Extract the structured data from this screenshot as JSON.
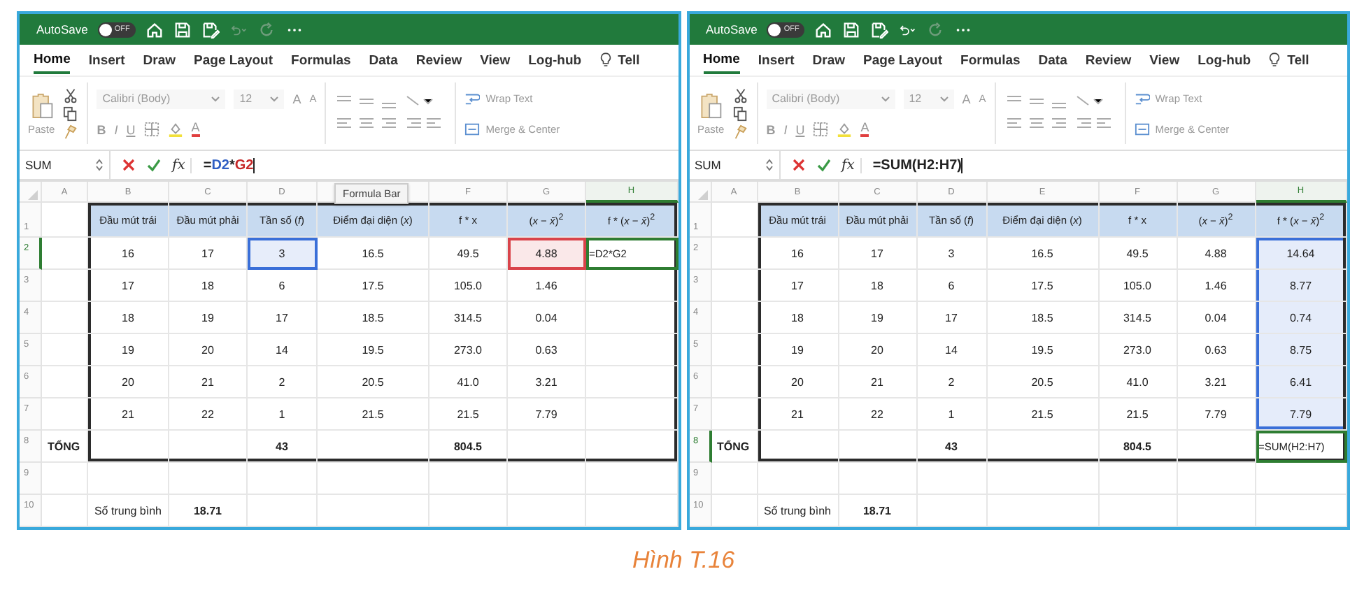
{
  "panels": [
    {
      "autosave": {
        "label": "AutoSave",
        "toggle": "OFF",
        "on": false
      },
      "undo_enabled": false,
      "tabs": [
        {
          "label": "Home",
          "selected": true
        },
        {
          "label": "Insert",
          "selected": false
        },
        {
          "label": "Draw",
          "selected": false
        },
        {
          "label": "Page Layout",
          "selected": false
        },
        {
          "label": "Formulas",
          "selected": false
        },
        {
          "label": "Data",
          "selected": false
        },
        {
          "label": "Review",
          "selected": false
        },
        {
          "label": "View",
          "selected": false
        },
        {
          "label": "Log-hub",
          "selected": false
        }
      ],
      "tell": "Tell",
      "ribbon": {
        "paste": "Paste",
        "font": "Calibri (Body)",
        "size": "12",
        "grow": "A",
        "shrink": "A",
        "styles": [
          "B",
          "I",
          "U"
        ],
        "font_color": "A",
        "wrap": "Wrap Text",
        "merge": "Merge & Center"
      },
      "name_box": "SUM",
      "fx": "fx",
      "formula_parts": [
        {
          "text": "=",
          "color": "#222222"
        },
        {
          "text": "D2",
          "color": "#2f5fc4"
        },
        {
          "text": "*",
          "color": "#222222"
        },
        {
          "text": "G2",
          "color": "#c62828"
        }
      ],
      "tooltip": "Formula Bar",
      "columns": [
        {
          "label": "A",
          "selected": false
        },
        {
          "label": "B",
          "selected": false
        },
        {
          "label": "C",
          "selected": false
        },
        {
          "label": "D",
          "selected": false
        },
        {
          "selected": false
        },
        {
          "label": "F",
          "selected": false
        },
        {
          "label": "G",
          "selected": false
        },
        {
          "label": "H",
          "selected": true
        }
      ],
      "rows": [
        {
          "n": "1",
          "selected": false,
          "cells": [
            {
              "kind": "plain"
            },
            {
              "text": "Đầu mút trái",
              "kind": "head"
            },
            {
              "text": "Đầu mút phải",
              "kind": "head"
            },
            {
              "text": "Tần số (*f*)",
              "kind": "head"
            },
            {
              "text": "Điểm đại diện (*x*)",
              "kind": "head"
            },
            {
              "text": "f * x",
              "kind": "head"
            },
            {
              "text": "(*x* − *x̄*)$^{2}$",
              "kind": "head"
            },
            {
              "text": "f * (*x* − *x̄*)$^{2}$",
              "kind": "head"
            }
          ]
        },
        {
          "n": "2",
          "selected": true,
          "cells": [
            {
              "kind": "plain"
            },
            {
              "text": "16",
              "kind": "plain"
            },
            {
              "text": "17",
              "kind": "plain"
            },
            {
              "text": "3",
              "kind": "ref",
              "color": "#3a6fd8"
            },
            {
              "text": "16.5",
              "kind": "plain"
            },
            {
              "text": "49.5",
              "kind": "plain"
            },
            {
              "text": "4.88",
              "kind": "ref",
              "color": "#d9434a"
            },
            {
              "text": "=D2*G2",
              "kind": "active",
              "color": "#2e7d32"
            }
          ]
        },
        {
          "n": "3",
          "selected": false,
          "cells": [
            {
              "kind": "plain"
            },
            {
              "text": "17",
              "kind": "plain"
            },
            {
              "text": "18",
              "kind": "plain"
            },
            {
              "text": "6",
              "kind": "plain"
            },
            {
              "text": "17.5",
              "kind": "plain"
            },
            {
              "text": "105.0",
              "kind": "plain"
            },
            {
              "text": "1.46",
              "kind": "plain"
            },
            {
              "kind": "plain"
            }
          ]
        },
        {
          "n": "4",
          "selected": false,
          "cells": [
            {
              "kind": "plain"
            },
            {
              "text": "18",
              "kind": "plain"
            },
            {
              "text": "19",
              "kind": "plain"
            },
            {
              "text": "17",
              "kind": "plain"
            },
            {
              "text": "18.5",
              "kind": "plain"
            },
            {
              "text": "314.5",
              "kind": "plain"
            },
            {
              "text": "0.04",
              "kind": "plain"
            },
            {
              "kind": "plain"
            }
          ]
        },
        {
          "n": "5",
          "selected": false,
          "cells": [
            {
              "kind": "plain"
            },
            {
              "text": "19",
              "kind": "plain"
            },
            {
              "text": "20",
              "kind": "plain"
            },
            {
              "text": "14",
              "kind": "plain"
            },
            {
              "text": "19.5",
              "kind": "plain"
            },
            {
              "text": "273.0",
              "kind": "plain"
            },
            {
              "text": "0.63",
              "kind": "plain"
            },
            {
              "kind": "plain"
            }
          ]
        },
        {
          "n": "6",
          "selected": false,
          "cells": [
            {
              "kind": "plain"
            },
            {
              "text": "20",
              "kind": "plain"
            },
            {
              "text": "21",
              "kind": "plain"
            },
            {
              "text": "2",
              "kind": "plain"
            },
            {
              "text": "20.5",
              "kind": "plain"
            },
            {
              "text": "41.0",
              "kind": "plain"
            },
            {
              "text": "3.21",
              "kind": "plain"
            },
            {
              "kind": "plain"
            }
          ]
        },
        {
          "n": "7",
          "selected": false,
          "cells": [
            {
              "kind": "plain"
            },
            {
              "text": "21",
              "kind": "plain"
            },
            {
              "text": "22",
              "kind": "plain"
            },
            {
              "text": "1",
              "kind": "plain"
            },
            {
              "text": "21.5",
              "kind": "plain"
            },
            {
              "text": "21.5",
              "kind": "plain"
            },
            {
              "text": "7.79",
              "kind": "plain"
            },
            {
              "kind": "plain"
            }
          ]
        },
        {
          "n": "8",
          "selected": false,
          "cells": [
            {
              "text": "TỔNG",
              "kind": "bold"
            },
            {
              "kind": "plain"
            },
            {
              "kind": "plain"
            },
            {
              "text": "43",
              "kind": "bold"
            },
            {
              "kind": "plain"
            },
            {
              "text": "804.5",
              "kind": "bold"
            },
            {
              "kind": "plain"
            },
            {
              "kind": "plain"
            }
          ]
        },
        {
          "n": "9",
          "selected": false,
          "cells": [
            {
              "kind": "plain"
            },
            {
              "kind": "plain"
            },
            {
              "kind": "plain"
            },
            {
              "kind": "plain"
            },
            {
              "kind": "plain"
            },
            {
              "kind": "plain"
            },
            {
              "kind": "plain"
            },
            {
              "kind": "plain"
            }
          ]
        },
        {
          "n": "10",
          "selected": false,
          "cells": [
            {
              "kind": "plain"
            },
            {
              "text": "Số trung bình",
              "kind": "plain"
            },
            {
              "text": "18.71",
              "kind": "bold"
            },
            {
              "kind": "plain"
            },
            {
              "kind": "plain"
            },
            {
              "kind": "plain"
            },
            {
              "kind": "plain"
            },
            {
              "kind": "plain"
            }
          ]
        }
      ]
    },
    {
      "autosave": {
        "label": "AutoSave",
        "toggle": "OFF",
        "on": false
      },
      "undo_enabled": true,
      "tabs": [
        {
          "label": "Home",
          "selected": true
        },
        {
          "label": "Insert",
          "selected": false
        },
        {
          "label": "Draw",
          "selected": false
        },
        {
          "label": "Page Layout",
          "selected": false
        },
        {
          "label": "Formulas",
          "selected": false
        },
        {
          "label": "Data",
          "selected": false
        },
        {
          "label": "Review",
          "selected": false
        },
        {
          "label": "View",
          "selected": false
        },
        {
          "label": "Log-hub",
          "selected": false
        }
      ],
      "tell": "Tell",
      "ribbon": {
        "paste": "Paste",
        "font": "Calibri (Body)",
        "size": "12",
        "grow": "A",
        "shrink": "A",
        "styles": [
          "B",
          "I",
          "U"
        ],
        "font_color": "A",
        "wrap": "Wrap Text",
        "merge": "Merge & Center"
      },
      "name_box": "SUM",
      "fx": "fx",
      "formula_parts": [
        {
          "text": "=SUM(H2:H7)",
          "color": "#222222"
        }
      ],
      "columns": [
        {
          "label": "A",
          "selected": false
        },
        {
          "label": "B",
          "selected": false
        },
        {
          "label": "C",
          "selected": false
        },
        {
          "label": "D",
          "selected": false
        },
        {
          "label": "E",
          "selected": false
        },
        {
          "label": "F",
          "selected": false
        },
        {
          "label": "G",
          "selected": false
        },
        {
          "label": "H",
          "selected": true
        }
      ],
      "rows": [
        {
          "n": "1",
          "selected": false,
          "cells": [
            {
              "kind": "plain"
            },
            {
              "text": "Đầu mút trái",
              "kind": "head"
            },
            {
              "text": "Đầu mút phải",
              "kind": "head"
            },
            {
              "text": "Tần số (*f*)",
              "kind": "head"
            },
            {
              "text": "Điểm đại diện (*x*)",
              "kind": "head"
            },
            {
              "text": "f * x",
              "kind": "head"
            },
            {
              "text": "(*x* − *x̄*)$^{2}$",
              "kind": "head"
            },
            {
              "text": "f * (*x* − *x̄*)$^{2}$",
              "kind": "head"
            }
          ]
        },
        {
          "n": "2",
          "selected": false,
          "cells": [
            {
              "kind": "plain"
            },
            {
              "text": "16",
              "kind": "plain"
            },
            {
              "text": "17",
              "kind": "plain"
            },
            {
              "text": "3",
              "kind": "plain"
            },
            {
              "text": "16.5",
              "kind": "plain"
            },
            {
              "text": "49.5",
              "kind": "plain"
            },
            {
              "text": "4.88",
              "kind": "plain"
            },
            {
              "text": "14.64",
              "kind": "range",
              "color": "#3a6fd8"
            }
          ]
        },
        {
          "n": "3",
          "selected": false,
          "cells": [
            {
              "kind": "plain"
            },
            {
              "text": "17",
              "kind": "plain"
            },
            {
              "text": "18",
              "kind": "plain"
            },
            {
              "text": "6",
              "kind": "plain"
            },
            {
              "text": "17.5",
              "kind": "plain"
            },
            {
              "text": "105.0",
              "kind": "plain"
            },
            {
              "text": "1.46",
              "kind": "plain"
            },
            {
              "text": "8.77",
              "kind": "range",
              "color": "#3a6fd8"
            }
          ]
        },
        {
          "n": "4",
          "selected": false,
          "cells": [
            {
              "kind": "plain"
            },
            {
              "text": "18",
              "kind": "plain"
            },
            {
              "text": "19",
              "kind": "plain"
            },
            {
              "text": "17",
              "kind": "plain"
            },
            {
              "text": "18.5",
              "kind": "plain"
            },
            {
              "text": "314.5",
              "kind": "plain"
            },
            {
              "text": "0.04",
              "kind": "plain"
            },
            {
              "text": "0.74",
              "kind": "range",
              "color": "#3a6fd8"
            }
          ]
        },
        {
          "n": "5",
          "selected": false,
          "cells": [
            {
              "kind": "plain"
            },
            {
              "text": "19",
              "kind": "plain"
            },
            {
              "text": "20",
              "kind": "plain"
            },
            {
              "text": "14",
              "kind": "plain"
            },
            {
              "text": "19.5",
              "kind": "plain"
            },
            {
              "text": "273.0",
              "kind": "plain"
            },
            {
              "text": "0.63",
              "kind": "plain"
            },
            {
              "text": "8.75",
              "kind": "range",
              "color": "#3a6fd8"
            }
          ]
        },
        {
          "n": "6",
          "selected": false,
          "cells": [
            {
              "kind": "plain"
            },
            {
              "text": "20",
              "kind": "plain"
            },
            {
              "text": "21",
              "kind": "plain"
            },
            {
              "text": "2",
              "kind": "plain"
            },
            {
              "text": "20.5",
              "kind": "plain"
            },
            {
              "text": "41.0",
              "kind": "plain"
            },
            {
              "text": "3.21",
              "kind": "plain"
            },
            {
              "text": "6.41",
              "kind": "range",
              "color": "#3a6fd8"
            }
          ]
        },
        {
          "n": "7",
          "selected": false,
          "cells": [
            {
              "kind": "plain"
            },
            {
              "text": "21",
              "kind": "plain"
            },
            {
              "text": "22",
              "kind": "plain"
            },
            {
              "text": "1",
              "kind": "plain"
            },
            {
              "text": "21.5",
              "kind": "plain"
            },
            {
              "text": "21.5",
              "kind": "plain"
            },
            {
              "text": "7.79",
              "kind": "plain"
            },
            {
              "text": "7.79",
              "kind": "range",
              "color": "#3a6fd8"
            }
          ]
        },
        {
          "n": "8",
          "selected": true,
          "cells": [
            {
              "text": "TỔNG",
              "kind": "bold"
            },
            {
              "kind": "plain"
            },
            {
              "kind": "plain"
            },
            {
              "text": "43",
              "kind": "bold"
            },
            {
              "kind": "plain"
            },
            {
              "text": "804.5",
              "kind": "bold"
            },
            {
              "kind": "plain"
            },
            {
              "text": "=SUM(H2:H7)",
              "kind": "active",
              "color": "#2e7d32"
            }
          ]
        },
        {
          "n": "9",
          "selected": false,
          "cells": [
            {
              "kind": "plain"
            },
            {
              "kind": "plain"
            },
            {
              "kind": "plain"
            },
            {
              "kind": "plain"
            },
            {
              "kind": "plain"
            },
            {
              "kind": "plain"
            },
            {
              "kind": "plain"
            },
            {
              "kind": "plain"
            }
          ]
        },
        {
          "n": "10",
          "selected": false,
          "cells": [
            {
              "kind": "plain"
            },
            {
              "text": "Số trung bình",
              "kind": "plain"
            },
            {
              "text": "18.71",
              "kind": "bold"
            },
            {
              "kind": "plain"
            },
            {
              "kind": "plain"
            },
            {
              "kind": "plain"
            },
            {
              "kind": "plain"
            },
            {
              "kind": "plain"
            }
          ]
        }
      ]
    }
  ],
  "caption": "Hình T.16"
}
